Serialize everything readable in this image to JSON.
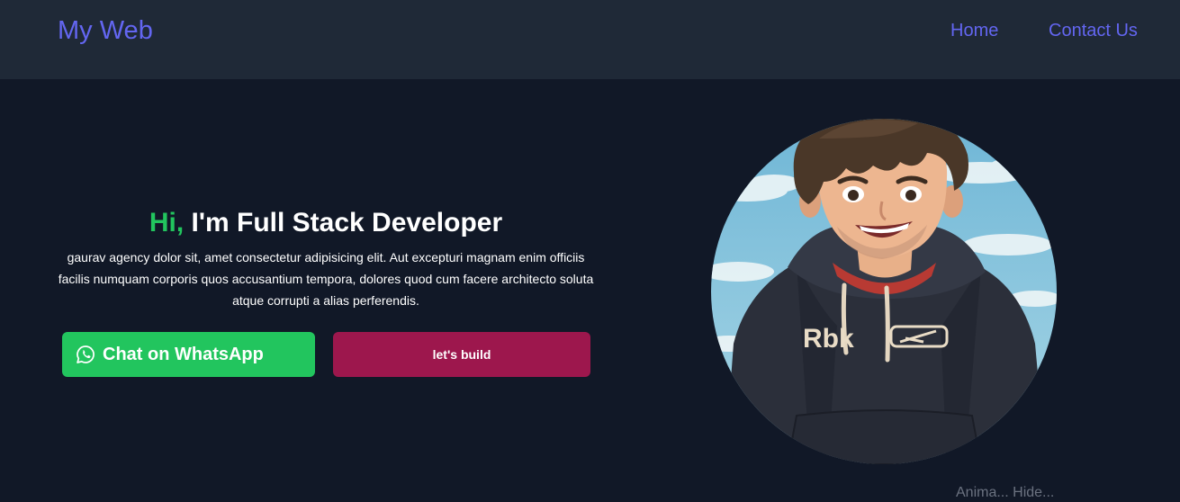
{
  "nav": {
    "brand": "My Web",
    "links": [
      {
        "label": "Home"
      },
      {
        "label": "Contact Us"
      }
    ]
  },
  "hero": {
    "greeting": "Hi,",
    "title": " I'm Full Stack Developer",
    "description": "gaurav agency dolor sit, amet consectetur adipisicing elit. Aut excepturi magnam enim officiis facilis numquam corporis quos accusantium tempora, dolores quod cum facere architecto soluta atque corrupti a alias perferendis.",
    "whatsapp_label": "Chat on WhatsApp",
    "build_label": "let's build"
  },
  "portrait": {
    "hoodie_text": "Rbk"
  },
  "caption": "Anima... Hide...",
  "colors": {
    "accent": "#6366f1",
    "green": "#22c55e",
    "build": "#9d174d",
    "background": "#111827",
    "navbar": "#1f2937"
  }
}
